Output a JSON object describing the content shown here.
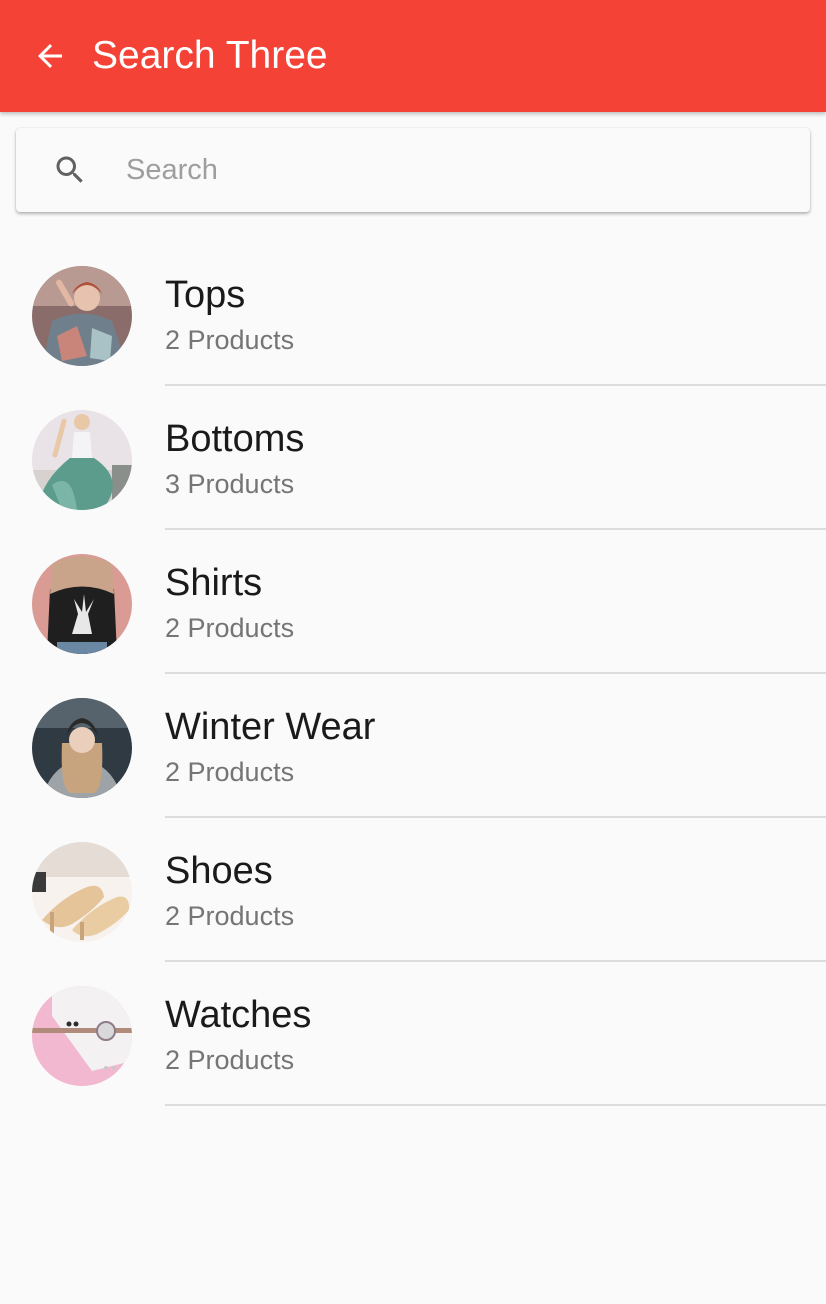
{
  "app_bar": {
    "title": "Search Three",
    "back_icon": "arrow-left-icon",
    "color": "#f44336"
  },
  "search": {
    "placeholder": "Search",
    "value": "",
    "icon": "search-icon"
  },
  "categories": [
    {
      "name": "Tops",
      "count": "2 Products"
    },
    {
      "name": "Bottoms",
      "count": "3 Products"
    },
    {
      "name": "Shirts",
      "count": "2 Products"
    },
    {
      "name": "Winter Wear",
      "count": "2 Products"
    },
    {
      "name": "Shoes",
      "count": "2 Products"
    },
    {
      "name": "Watches",
      "count": "2 Products"
    }
  ]
}
